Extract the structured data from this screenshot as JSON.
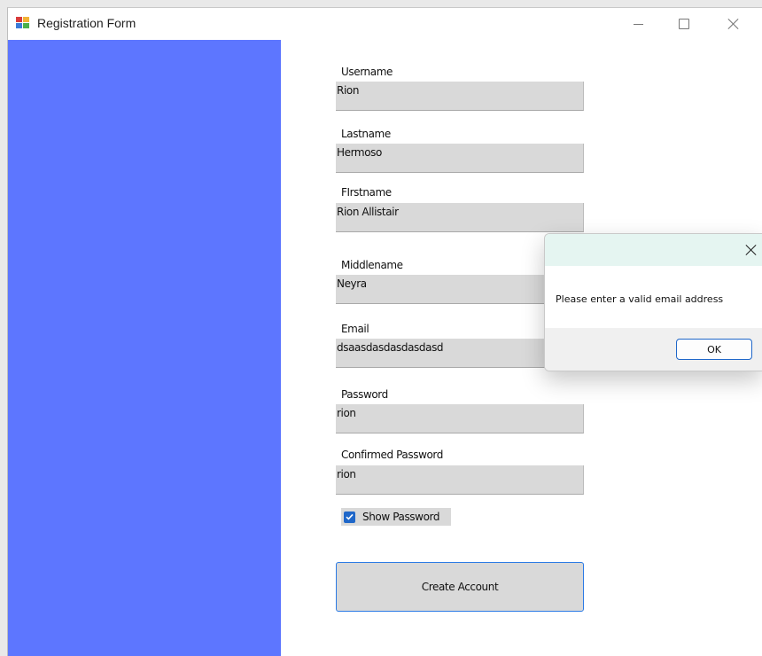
{
  "window": {
    "title": "Registration Form",
    "side_panel_color": "#5d76ff",
    "app_icon": "winforms-app-icon"
  },
  "form": {
    "fields": [
      {
        "label": "Username",
        "value": "Rion"
      },
      {
        "label": "Lastname",
        "value": "Hermoso"
      },
      {
        "label": "FIrstname",
        "value": "Rion Allistair"
      },
      {
        "label": "Middlename",
        "value": "Neyra"
      },
      {
        "label": "Email",
        "value": "dsaasdasdasdasdasd"
      },
      {
        "label": "Password",
        "value": "rion"
      },
      {
        "label": "Confirmed Password",
        "value": "rion"
      }
    ],
    "show_password": {
      "label": "Show Password",
      "checked": true
    },
    "create_button": "Create Account"
  },
  "dialog": {
    "title": "",
    "message": "Please enter a valid email address",
    "ok_label": "OK",
    "accent_color": "#1f67c9"
  }
}
